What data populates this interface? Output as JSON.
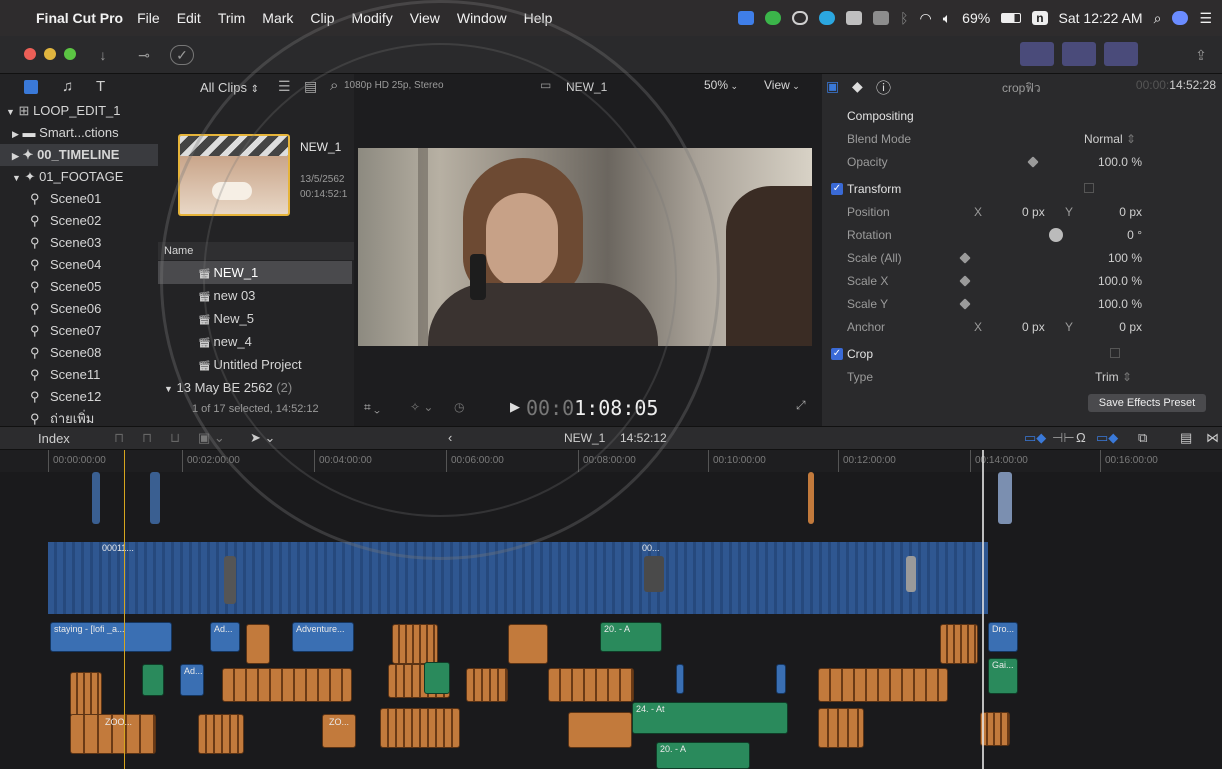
{
  "menubar": {
    "app_name": "Final Cut Pro",
    "menus": [
      "File",
      "Edit",
      "Trim",
      "Mark",
      "Clip",
      "Modify",
      "View",
      "Window",
      "Help"
    ],
    "battery": "69%",
    "datetime": "Sat 12:22 AM",
    "input_source": "n"
  },
  "browser": {
    "filter": "All Clips",
    "format": "1080p HD 25p, Stereo",
    "selected_clip": {
      "name": "NEW_1",
      "date": "13/5/2562",
      "duration": "00:14:52:1"
    },
    "list_header": "Name",
    "items": [
      "NEW_1",
      "new 03",
      "New_5",
      "new_4",
      "Untitled Project"
    ],
    "group_label": "13 May BE 2562",
    "group_count": "(2)",
    "selection_status": "1 of 17 selected, 14:52:12"
  },
  "sidebar": {
    "library": "LOOP_EDIT_1",
    "rows": [
      "Smart...ctions",
      "00_TIMELINE",
      "01_FOOTAGE",
      "Scene01",
      "Scene02",
      "Scene03",
      "Scene04",
      "Scene05",
      "Scene06",
      "Scene07",
      "Scene08",
      "Scene11",
      "Scene12",
      "ถ่ายเพิ่ม"
    ]
  },
  "viewer": {
    "project_name": "NEW_1",
    "zoom": "50%",
    "view_menu": "View",
    "timecode": "00:01:08:05",
    "timecode_dim": "00:0",
    "timecode_bright": "1:08:05"
  },
  "inspector": {
    "title": "cropฟิว",
    "duration": "14:52:28",
    "duration_dim": "00:00:",
    "compositing": "Compositing",
    "blend_mode_label": "Blend Mode",
    "blend_mode_value": "Normal",
    "opacity_label": "Opacity",
    "opacity_value": "100.0",
    "transform": "Transform",
    "position_label": "Position",
    "position_x": "0",
    "position_y": "0",
    "rotation_label": "Rotation",
    "rotation_value": "0",
    "scale_all_label": "Scale (All)",
    "scale_all_value": "100",
    "scale_x_label": "Scale X",
    "scale_x_value": "100.0",
    "scale_y_label": "Scale Y",
    "scale_y_value": "100.0",
    "anchor_label": "Anchor",
    "anchor_x": "0",
    "anchor_y": "0",
    "crop": "Crop",
    "type_label": "Type",
    "type_value": "Trim",
    "save_preset": "Save Effects Preset",
    "unit_px": "px",
    "unit_pct": "%",
    "unit_deg": "°",
    "axis_x": "X",
    "axis_y": "Y"
  },
  "timeline": {
    "index_label": "Index",
    "project_name": "NEW_1",
    "project_duration": "14:52:12",
    "ruler": [
      "00:00:00:00",
      "00:02:00:00",
      "00:04:00:00",
      "00:06:00:00",
      "00:08:00:00",
      "00:10:00:00",
      "00:12:00:00",
      "00:14:00:00",
      "00:16:00:00"
    ],
    "clip_labels": [
      "staying - [lofi _a...",
      "Ad...",
      "Adventure...",
      "20. - A",
      "24. - At",
      "20. - A",
      "Dro...",
      "Gai...",
      "ZOO...",
      "ZO...",
      "00011...",
      "00..."
    ]
  },
  "colors": {
    "accent": "#3a6ad6",
    "playhead": "#d6a51e",
    "audio_orange": "#c27a3c",
    "audio_green": "#2a8a5c",
    "video_blue": "#3a6fb3"
  }
}
